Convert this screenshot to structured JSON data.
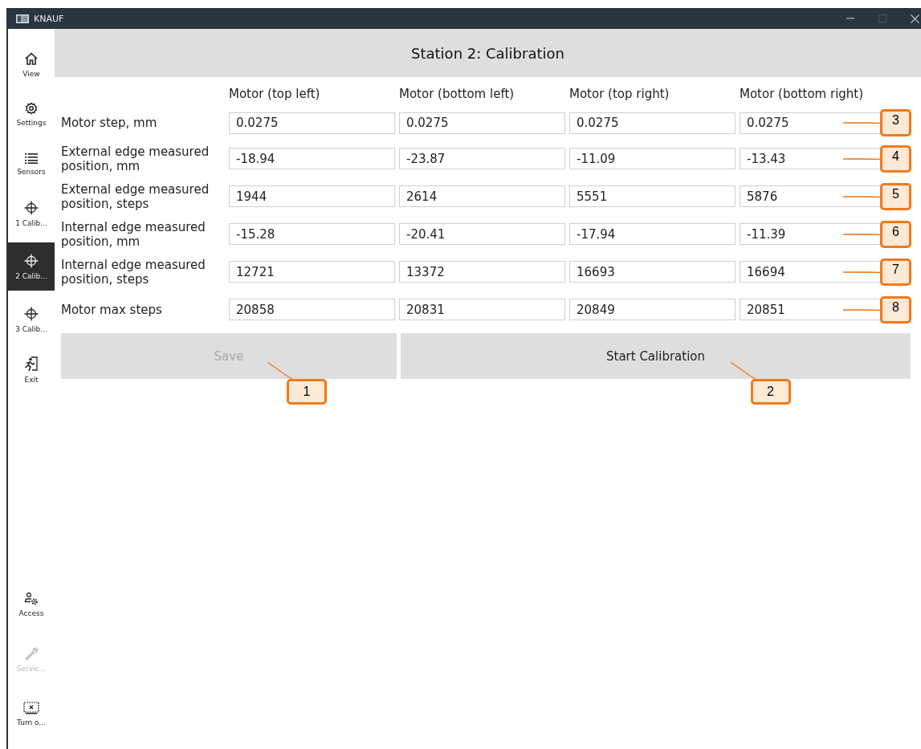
{
  "window": {
    "title": "KNAUF"
  },
  "sidebar": {
    "items": [
      {
        "label": "View",
        "kind": "home",
        "selected": false,
        "disabled": false
      },
      {
        "label": "Settings",
        "kind": "gear",
        "selected": false,
        "disabled": false
      },
      {
        "label": "Sensors",
        "kind": "list",
        "selected": false,
        "disabled": false
      },
      {
        "label": "1 Calib...",
        "kind": "crosshair",
        "selected": false,
        "disabled": false
      },
      {
        "label": "2 Calib...",
        "kind": "crosshair",
        "selected": true,
        "disabled": false
      },
      {
        "label": "3 Calib...",
        "kind": "crosshair",
        "selected": false,
        "disabled": false
      },
      {
        "label": "Exit",
        "kind": "exit",
        "selected": false,
        "disabled": false
      }
    ],
    "bottom_items": [
      {
        "label": "Access",
        "kind": "access",
        "selected": false,
        "disabled": false
      },
      {
        "label": "Servic...",
        "kind": "wrench",
        "selected": false,
        "disabled": true
      },
      {
        "label": "Turn o...",
        "kind": "screen",
        "selected": false,
        "disabled": false
      }
    ]
  },
  "header": {
    "title": "Station 2: Calibration"
  },
  "table": {
    "columns": [
      "Motor (top left)",
      "Motor (bottom left)",
      "Motor (top right)",
      "Motor (bottom right)"
    ],
    "rows": [
      {
        "label": "Motor step, mm",
        "values": [
          "0.0275",
          "0.0275",
          "0.0275",
          "0.0275"
        ],
        "callout": "3"
      },
      {
        "label": "External edge measured position, mm",
        "values": [
          "-18.94",
          "-23.87",
          "-11.09",
          "-13.43"
        ],
        "callout": "4"
      },
      {
        "label": "External edge measured position, steps",
        "values": [
          "1944",
          "2614",
          "5551",
          "5876"
        ],
        "callout": "5"
      },
      {
        "label": "Internal edge measured position, mm",
        "values": [
          "-15.28",
          "-20.41",
          "-17.94",
          "-11.39"
        ],
        "callout": "6"
      },
      {
        "label": "Internal edge measured position, steps",
        "values": [
          "12721",
          "13372",
          "16693",
          "16694"
        ],
        "callout": "7"
      },
      {
        "label": "Motor max steps",
        "values": [
          "20858",
          "20831",
          "20849",
          "20851"
        ],
        "callout": "8"
      }
    ]
  },
  "buttons": [
    {
      "label": "Save",
      "disabled": true,
      "callout": "1"
    },
    {
      "label": "Start Calibration",
      "disabled": false,
      "callout": "2"
    }
  ]
}
